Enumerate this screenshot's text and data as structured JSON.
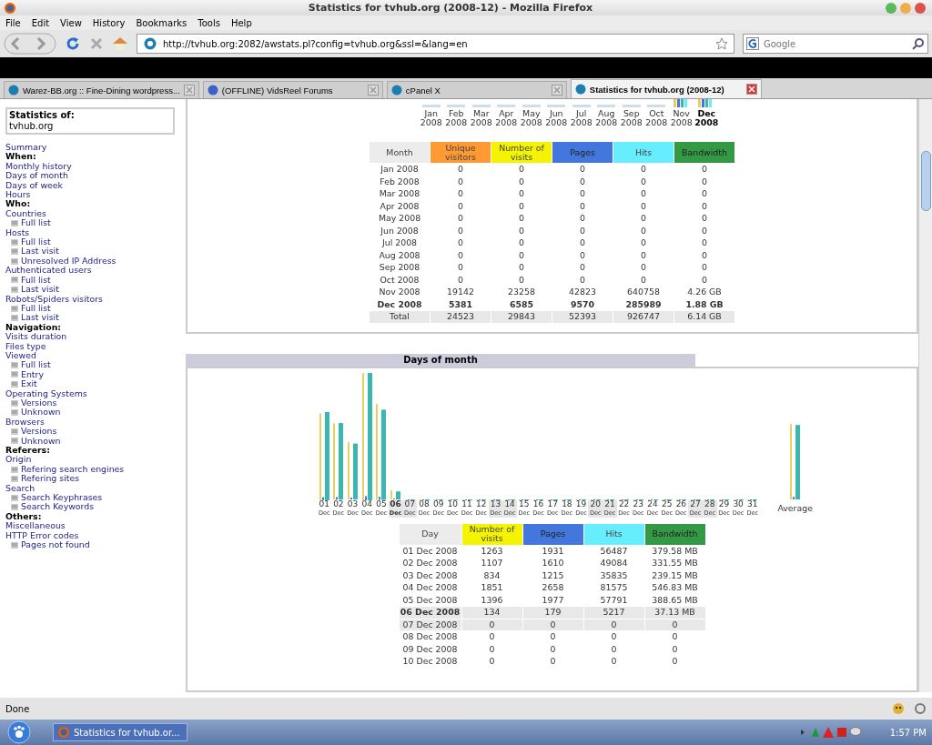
{
  "window": {
    "title": "Statistics for tvhub.org (2008-12) - Mozilla Firefox"
  },
  "menu": [
    "File",
    "Edit",
    "View",
    "History",
    "Bookmarks",
    "Tools",
    "Help"
  ],
  "toolbar": {
    "url": "http://tvhub.org:2082/awstats.pl?config=tvhub.org&ssl=&lang=en",
    "search_placeholder": "Google"
  },
  "tabs": [
    {
      "label": "Warez-BB.org :: Fine-Dining wordpress...",
      "selected": false
    },
    {
      "label": "(OFFLINE) VidsReel Forums",
      "selected": false
    },
    {
      "label": "cPanel X",
      "selected": false
    },
    {
      "label": "Statistics for tvhub.org (2008-12)",
      "selected": true
    }
  ],
  "sidebar": {
    "title": "Statistics of:",
    "site": "tvhub.org",
    "items": [
      {
        "label": "Summary",
        "kind": "link"
      },
      {
        "label": "When:",
        "kind": "heading"
      },
      {
        "label": "Monthly history",
        "kind": "link"
      },
      {
        "label": "Days of month",
        "kind": "link"
      },
      {
        "label": "Days of week",
        "kind": "link"
      },
      {
        "label": "Hours",
        "kind": "link"
      },
      {
        "label": "Who:",
        "kind": "heading"
      },
      {
        "label": "Countries",
        "kind": "link"
      },
      {
        "label": "Full list",
        "kind": "sub"
      },
      {
        "label": "Hosts",
        "kind": "link"
      },
      {
        "label": "Full list",
        "kind": "sub"
      },
      {
        "label": "Last visit",
        "kind": "sub"
      },
      {
        "label": "Unresolved IP Address",
        "kind": "sub"
      },
      {
        "label": "Authenticated users",
        "kind": "link"
      },
      {
        "label": "Full list",
        "kind": "sub"
      },
      {
        "label": "Last visit",
        "kind": "sub"
      },
      {
        "label": "Robots/Spiders visitors",
        "kind": "link"
      },
      {
        "label": "Full list",
        "kind": "sub"
      },
      {
        "label": "Last visit",
        "kind": "sub"
      },
      {
        "label": "Navigation:",
        "kind": "heading"
      },
      {
        "label": "Visits duration",
        "kind": "link"
      },
      {
        "label": "Files type",
        "kind": "link"
      },
      {
        "label": "Viewed",
        "kind": "link"
      },
      {
        "label": "Full list",
        "kind": "sub"
      },
      {
        "label": "Entry",
        "kind": "sub"
      },
      {
        "label": "Exit",
        "kind": "sub"
      },
      {
        "label": "Operating Systems",
        "kind": "link"
      },
      {
        "label": "Versions",
        "kind": "sub"
      },
      {
        "label": "Unknown",
        "kind": "sub"
      },
      {
        "label": "Browsers",
        "kind": "link"
      },
      {
        "label": "Versions",
        "kind": "sub"
      },
      {
        "label": "Unknown",
        "kind": "sub"
      },
      {
        "label": "Referers:",
        "kind": "heading"
      },
      {
        "label": "Origin",
        "kind": "link"
      },
      {
        "label": "Refering search engines",
        "kind": "sub"
      },
      {
        "label": "Refering sites",
        "kind": "sub"
      },
      {
        "label": "Search",
        "kind": "link"
      },
      {
        "label": "Search Keyphrases",
        "kind": "sub"
      },
      {
        "label": "Search Keywords",
        "kind": "sub"
      },
      {
        "label": "Others:",
        "kind": "heading"
      },
      {
        "label": "Miscellaneous",
        "kind": "link"
      },
      {
        "label": "HTTP Error codes",
        "kind": "link"
      },
      {
        "label": "Pages not found",
        "kind": "sub"
      }
    ]
  },
  "monthly": {
    "months": [
      {
        "month": "Jan",
        "year": "2008",
        "selected": false
      },
      {
        "month": "Feb",
        "year": "2008",
        "selected": false
      },
      {
        "month": "Mar",
        "year": "2008",
        "selected": false
      },
      {
        "month": "Apr",
        "year": "2008",
        "selected": false
      },
      {
        "month": "May",
        "year": "2008",
        "selected": false
      },
      {
        "month": "Jun",
        "year": "2008",
        "selected": false
      },
      {
        "month": "Jul",
        "year": "2008",
        "selected": false
      },
      {
        "month": "Aug",
        "year": "2008",
        "selected": false
      },
      {
        "month": "Sep",
        "year": "2008",
        "selected": false
      },
      {
        "month": "Oct",
        "year": "2008",
        "selected": false
      },
      {
        "month": "Nov",
        "year": "2008",
        "selected": false
      },
      {
        "month": "Dec",
        "year": "2008",
        "selected": true
      }
    ],
    "columns": [
      {
        "label": "Month",
        "kind": "label"
      },
      {
        "label": "Unique visitors",
        "kind": "unique"
      },
      {
        "label": "Number of visits",
        "kind": "visits"
      },
      {
        "label": "Pages",
        "kind": "pages"
      },
      {
        "label": "Hits",
        "kind": "hits"
      },
      {
        "label": "Bandwidth",
        "kind": "bandwidth"
      }
    ],
    "rows": [
      {
        "cells": [
          "Jan 2008",
          "0",
          "0",
          "0",
          "0",
          "0"
        ],
        "selected": false,
        "kind": "row"
      },
      {
        "cells": [
          "Feb 2008",
          "0",
          "0",
          "0",
          "0",
          "0"
        ],
        "selected": false,
        "kind": "row"
      },
      {
        "cells": [
          "Mar 2008",
          "0",
          "0",
          "0",
          "0",
          "0"
        ],
        "selected": false,
        "kind": "row"
      },
      {
        "cells": [
          "Apr 2008",
          "0",
          "0",
          "0",
          "0",
          "0"
        ],
        "selected": false,
        "kind": "row"
      },
      {
        "cells": [
          "May 2008",
          "0",
          "0",
          "0",
          "0",
          "0"
        ],
        "selected": false,
        "kind": "row"
      },
      {
        "cells": [
          "Jun 2008",
          "0",
          "0",
          "0",
          "0",
          "0"
        ],
        "selected": false,
        "kind": "row"
      },
      {
        "cells": [
          "Jul 2008",
          "0",
          "0",
          "0",
          "0",
          "0"
        ],
        "selected": false,
        "kind": "row"
      },
      {
        "cells": [
          "Aug 2008",
          "0",
          "0",
          "0",
          "0",
          "0"
        ],
        "selected": false,
        "kind": "row"
      },
      {
        "cells": [
          "Sep 2008",
          "0",
          "0",
          "0",
          "0",
          "0"
        ],
        "selected": false,
        "kind": "row"
      },
      {
        "cells": [
          "Oct 2008",
          "0",
          "0",
          "0",
          "0",
          "0"
        ],
        "selected": false,
        "kind": "row"
      },
      {
        "cells": [
          "Nov 2008",
          "19142",
          "23258",
          "42823",
          "640758",
          "4.26 GB"
        ],
        "selected": false,
        "kind": "row"
      },
      {
        "cells": [
          "Dec 2008",
          "5381",
          "6585",
          "9570",
          "285989",
          "1.88 GB"
        ],
        "selected": true,
        "kind": "row"
      },
      {
        "cells": [
          "Total",
          "24523",
          "29843",
          "52393",
          "926747",
          "6.14 GB"
        ],
        "selected": false,
        "kind": "total"
      }
    ]
  },
  "days": {
    "title": "Days of month",
    "average_label": "Average",
    "chart_labels": [
      {
        "day": "01",
        "month": "Dec",
        "selected": false,
        "weekend": false
      },
      {
        "day": "02",
        "month": "Dec",
        "selected": false,
        "weekend": false
      },
      {
        "day": "03",
        "month": "Dec",
        "selected": false,
        "weekend": false
      },
      {
        "day": "04",
        "month": "Dec",
        "selected": false,
        "weekend": false
      },
      {
        "day": "05",
        "month": "Dec",
        "selected": false,
        "weekend": false
      },
      {
        "day": "06",
        "month": "Dec",
        "selected": true,
        "weekend": true
      },
      {
        "day": "07",
        "month": "Dec",
        "selected": false,
        "weekend": true
      },
      {
        "day": "08",
        "month": "Dec",
        "selected": false,
        "weekend": false
      },
      {
        "day": "09",
        "month": "Dec",
        "selected": false,
        "weekend": false
      },
      {
        "day": "10",
        "month": "Dec",
        "selected": false,
        "weekend": false
      },
      {
        "day": "11",
        "month": "Dec",
        "selected": false,
        "weekend": false
      },
      {
        "day": "12",
        "month": "Dec",
        "selected": false,
        "weekend": false
      },
      {
        "day": "13",
        "month": "Dec",
        "selected": false,
        "weekend": true
      },
      {
        "day": "14",
        "month": "Dec",
        "selected": false,
        "weekend": true
      },
      {
        "day": "15",
        "month": "Dec",
        "selected": false,
        "weekend": false
      },
      {
        "day": "16",
        "month": "Dec",
        "selected": false,
        "weekend": false
      },
      {
        "day": "17",
        "month": "Dec",
        "selected": false,
        "weekend": false
      },
      {
        "day": "18",
        "month": "Dec",
        "selected": false,
        "weekend": false
      },
      {
        "day": "19",
        "month": "Dec",
        "selected": false,
        "weekend": false
      },
      {
        "day": "20",
        "month": "Dec",
        "selected": false,
        "weekend": true
      },
      {
        "day": "21",
        "month": "Dec",
        "selected": false,
        "weekend": true
      },
      {
        "day": "22",
        "month": "Dec",
        "selected": false,
        "weekend": false
      },
      {
        "day": "23",
        "month": "Dec",
        "selected": false,
        "weekend": false
      },
      {
        "day": "24",
        "month": "Dec",
        "selected": false,
        "weekend": false
      },
      {
        "day": "25",
        "month": "Dec",
        "selected": false,
        "weekend": false
      },
      {
        "day": "26",
        "month": "Dec",
        "selected": false,
        "weekend": false
      },
      {
        "day": "27",
        "month": "Dec",
        "selected": false,
        "weekend": true
      },
      {
        "day": "28",
        "month": "Dec",
        "selected": false,
        "weekend": true
      },
      {
        "day": "29",
        "month": "Dec",
        "selected": false,
        "weekend": false
      },
      {
        "day": "30",
        "month": "Dec",
        "selected": false,
        "weekend": false
      },
      {
        "day": "31",
        "month": "Dec",
        "selected": false,
        "weekend": false
      }
    ],
    "columns": [
      {
        "label": "Day",
        "kind": "label"
      },
      {
        "label": "Number of visits",
        "kind": "visits"
      },
      {
        "label": "Pages",
        "kind": "pages"
      },
      {
        "label": "Hits",
        "kind": "hits"
      },
      {
        "label": "Bandwidth",
        "kind": "bandwidth"
      }
    ],
    "rows": [
      {
        "cells": [
          "01 Dec 2008",
          "1263",
          "1931",
          "56487",
          "379.58 MB"
        ],
        "selected": false,
        "weekend": false
      },
      {
        "cells": [
          "02 Dec 2008",
          "1107",
          "1610",
          "49084",
          "331.55 MB"
        ],
        "selected": false,
        "weekend": false
      },
      {
        "cells": [
          "03 Dec 2008",
          "834",
          "1215",
          "35835",
          "239.15 MB"
        ],
        "selected": false,
        "weekend": false
      },
      {
        "cells": [
          "04 Dec 2008",
          "1851",
          "2658",
          "81575",
          "546.83 MB"
        ],
        "selected": false,
        "weekend": false
      },
      {
        "cells": [
          "05 Dec 2008",
          "1396",
          "1977",
          "57791",
          "388.65 MB"
        ],
        "selected": false,
        "weekend": false
      },
      {
        "cells": [
          "06 Dec 2008",
          "134",
          "179",
          "5217",
          "37.13 MB"
        ],
        "selected": true,
        "weekend": true
      },
      {
        "cells": [
          "07 Dec 2008",
          "0",
          "0",
          "0",
          "0"
        ],
        "selected": false,
        "weekend": true
      },
      {
        "cells": [
          "08 Dec 2008",
          "0",
          "0",
          "0",
          "0"
        ],
        "selected": false,
        "weekend": false
      },
      {
        "cells": [
          "09 Dec 2008",
          "0",
          "0",
          "0",
          "0"
        ],
        "selected": false,
        "weekend": false
      },
      {
        "cells": [
          "10 Dec 2008",
          "0",
          "0",
          "0",
          "0"
        ],
        "selected": false,
        "weekend": false
      }
    ]
  },
  "status": "Done",
  "taskbar": {
    "task": "Statistics for tvhub.or...",
    "clock": "1:57 PM"
  }
}
